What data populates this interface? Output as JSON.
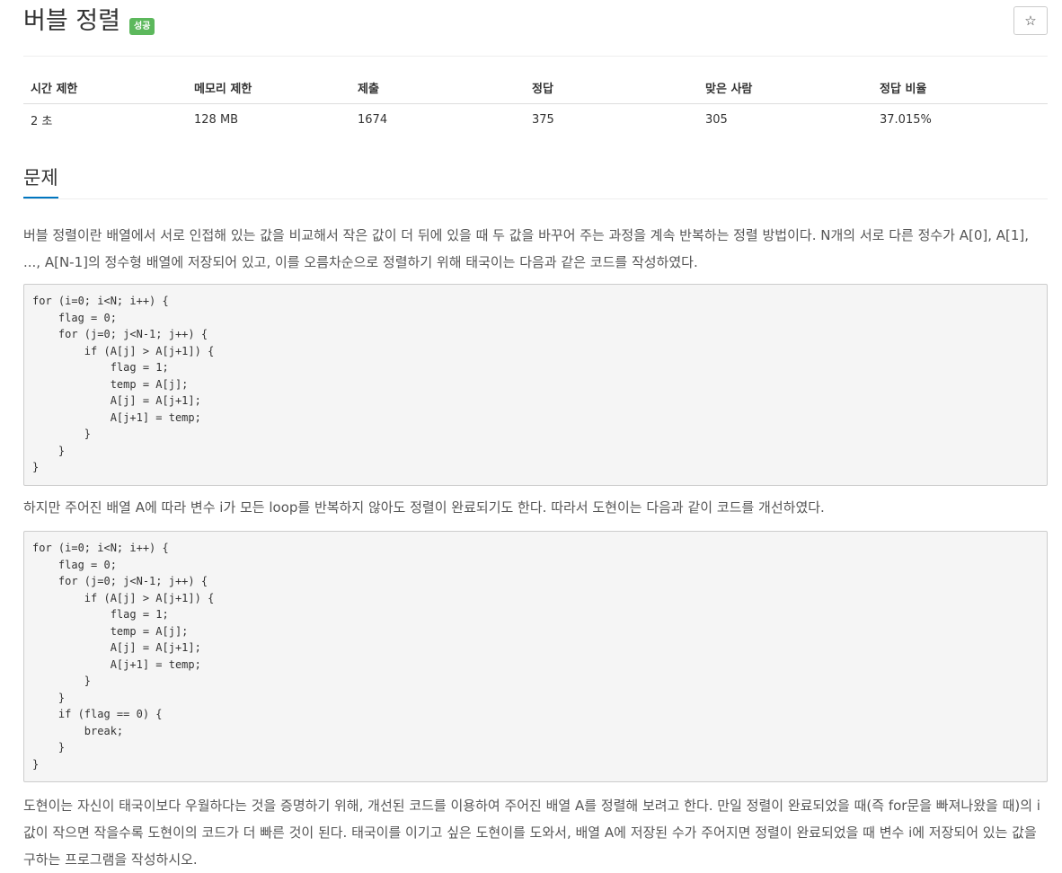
{
  "problem": {
    "title": "버블 정렬",
    "status_badge": "성공",
    "star_icon": "☆"
  },
  "info_table": {
    "headers": [
      "시간 제한",
      "메모리 제한",
      "제출",
      "정답",
      "맞은 사람",
      "정답 비율"
    ],
    "values": [
      "2 초",
      "128 MB",
      "1674",
      "375",
      "305",
      "37.015%"
    ]
  },
  "section": {
    "title": "문제",
    "paragraph1": "버블 정렬이란 배열에서 서로 인접해 있는 값을 비교해서 작은 값이 더 뒤에 있을 때 두 값을 바꾸어 주는 과정을 계속 반복하는 정렬 방법이다. N개의 서로 다른 정수가 A[0], A[1], ..., A[N-1]의 정수형 배열에 저장되어 있고, 이를 오름차순으로 정렬하기 위해 태국이는 다음과 같은 코드를 작성하였다.",
    "code1": "for (i=0; i<N; i++) {\n    flag = 0;\n    for (j=0; j<N-1; j++) {\n        if (A[j] > A[j+1]) {\n            flag = 1;\n            temp = A[j];\n            A[j] = A[j+1];\n            A[j+1] = temp;\n        }\n    }\n}",
    "paragraph2": "하지만 주어진 배열 A에 따라 변수 i가 모든 loop를 반복하지 않아도 정렬이 완료되기도 한다. 따라서 도현이는 다음과 같이 코드를 개선하였다.",
    "code2": "for (i=0; i<N; i++) {\n    flag = 0;\n    for (j=0; j<N-1; j++) {\n        if (A[j] > A[j+1]) {\n            flag = 1;\n            temp = A[j];\n            A[j] = A[j+1];\n            A[j+1] = temp;\n        }\n    }\n    if (flag == 0) {\n        break;\n    }\n}",
    "paragraph3": "도현이는 자신이 태국이보다 우월하다는 것을 증명하기 위해, 개선된 코드를 이용하여 주어진 배열 A를 정렬해 보려고 한다. 만일 정렬이 완료되었을 때(즉 for문을 빠져나왔을 때)의 i값이 작으면 작을수록 도현이의 코드가 더 빠른 것이 된다. 태국이를 이기고 싶은 도현이를 도와서, 배열 A에 저장된 수가 주어지면 정렬이 완료되었을 때 변수 i에 저장되어 있는 값을 구하는 프로그램을 작성하시오."
  },
  "colors": {
    "badge_bg": "#5cb85c",
    "section_underline": "#0076c0",
    "code_bg": "#f5f5f5"
  }
}
